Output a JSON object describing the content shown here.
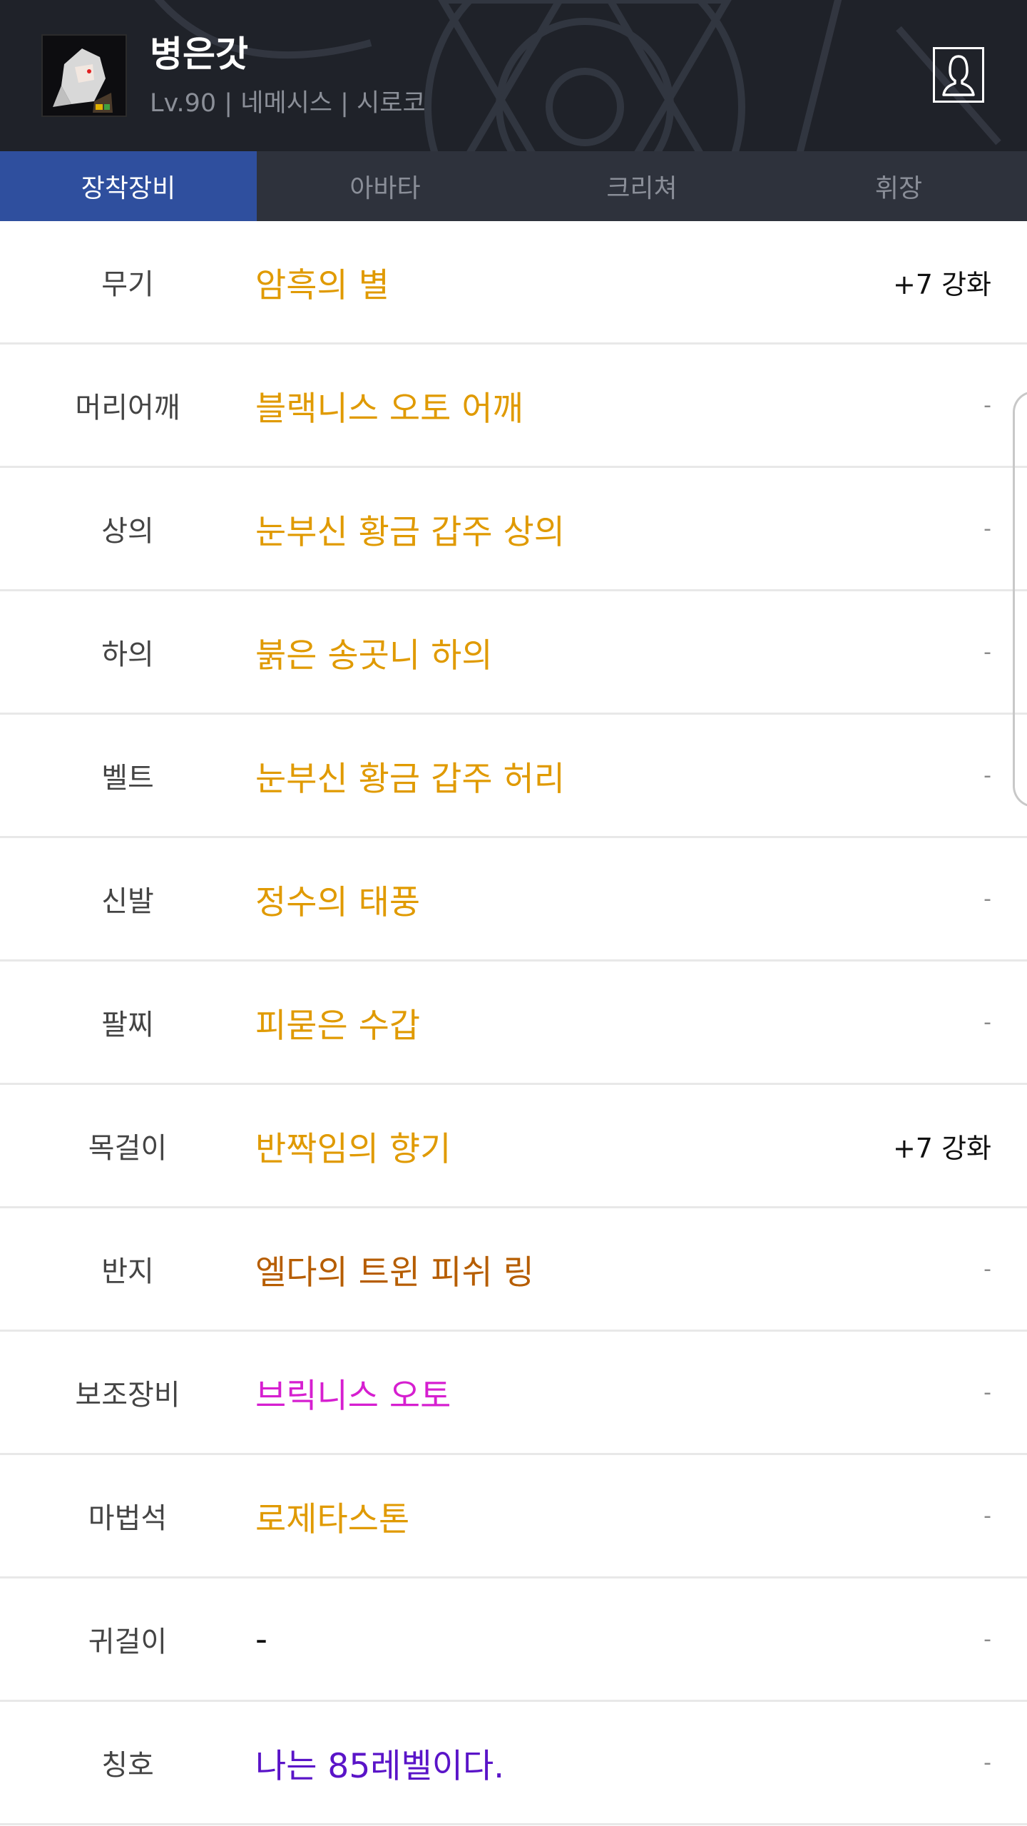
{
  "character": {
    "name": "병은갓",
    "meta": "Lv.90 | 네메시스 | 시로코"
  },
  "tabs": [
    {
      "label": "장착장비",
      "active": true
    },
    {
      "label": "아바타",
      "active": false
    },
    {
      "label": "크리쳐",
      "active": false
    },
    {
      "label": "휘장",
      "active": false
    }
  ],
  "equipment": [
    {
      "slot": "무기",
      "item": "암흑의 별",
      "color": "#e09a00",
      "enhance": "+7 강화"
    },
    {
      "slot": "머리어깨",
      "item": "블랙니스 오토 어깨",
      "color": "#e09a00",
      "enhance": "-"
    },
    {
      "slot": "상의",
      "item": "눈부신 황금 갑주 상의",
      "color": "#e09a00",
      "enhance": "-"
    },
    {
      "slot": "하의",
      "item": "붉은 송곳니 하의",
      "color": "#e09a00",
      "enhance": "-"
    },
    {
      "slot": "벨트",
      "item": "눈부신 황금 갑주 허리",
      "color": "#e09a00",
      "enhance": "-"
    },
    {
      "slot": "신발",
      "item": "정수의 태풍",
      "color": "#e09a00",
      "enhance": "-"
    },
    {
      "slot": "팔찌",
      "item": "피묻은 수갑",
      "color": "#e09a00",
      "enhance": "-"
    },
    {
      "slot": "목걸이",
      "item": "반짝임의 향기",
      "color": "#e09a00",
      "enhance": "+7 강화"
    },
    {
      "slot": "반지",
      "item": "엘다의 트윈 피쉬 링",
      "color": "#b65d00",
      "enhance": "-"
    },
    {
      "slot": "보조장비",
      "item": "브릭니스 오토",
      "color": "#d61fd0",
      "enhance": "-"
    },
    {
      "slot": "마법석",
      "item": "로제타스톤",
      "color": "#e09a00",
      "enhance": "-"
    },
    {
      "slot": "귀걸이",
      "item": "-",
      "color": "#111111",
      "enhance": "-"
    },
    {
      "slot": "칭호",
      "item": "나는 85레벨이다.",
      "color": "#5a14c8",
      "enhance": "-"
    }
  ],
  "icons": {
    "profile": "person-icon",
    "avatar": "character-portrait"
  }
}
